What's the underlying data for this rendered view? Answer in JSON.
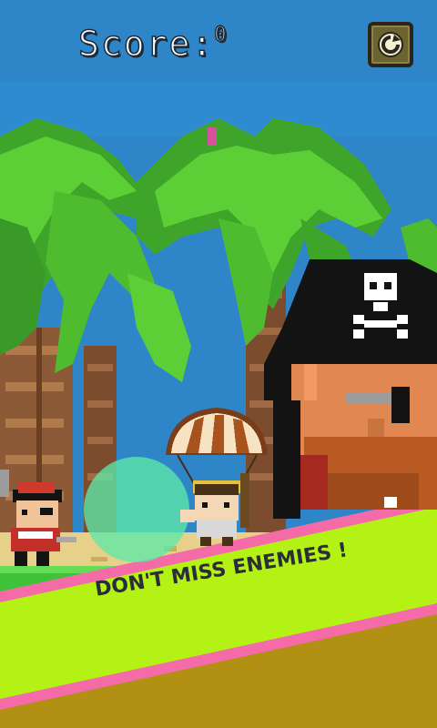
{
  "hud": {
    "score_label": "Score:",
    "score_value": "0",
    "restart_icon": "restart-icon"
  },
  "banner": {
    "message": "DON'T MISS ENEMIES !"
  },
  "colors": {
    "sky": "#2e86c9",
    "palm_leaf": "#4fbb2e",
    "trunk": "#8c5a36",
    "banner_fill": "#b3f214",
    "banner_border": "#f46ba8",
    "ground": "#b29014",
    "grass": "#3fc23a",
    "touch_circle": "#5ee8a8"
  },
  "entities": {
    "player": "parachuting-girl",
    "enemy": "pirate",
    "boss": "giant-pirate"
  }
}
